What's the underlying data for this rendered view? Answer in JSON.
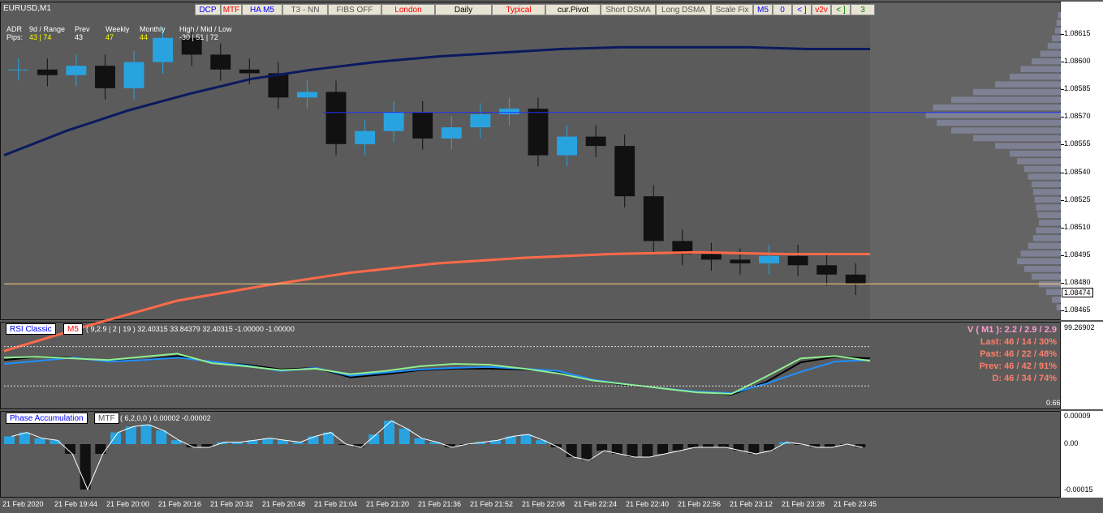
{
  "window": {
    "symbol_title": "EURUSD,M1"
  },
  "toolbar": [
    {
      "label": "DCP",
      "color": "#0000ff"
    },
    {
      "label": "MTF",
      "color": "#ff0000"
    },
    {
      "label": "HA M5",
      "color": "#0000ff"
    },
    {
      "label": "T3 - NN",
      "color": "#555555"
    },
    {
      "label": "FIBS OFF",
      "color": "#555555"
    },
    {
      "label": "London",
      "color": "#ff0000"
    },
    {
      "label": "Daily",
      "color": "#000000"
    },
    {
      "label": "Typical",
      "color": "#ff0000"
    },
    {
      "label": "cur.Pivot",
      "color": "#000000"
    },
    {
      "label": "Short DSMA",
      "color": "#555555"
    },
    {
      "label": "Long DSMA",
      "color": "#555555"
    },
    {
      "label": "Scale Fix",
      "color": "#555555"
    },
    {
      "label": "M5",
      "color": "#0000ff"
    },
    {
      "label": "0",
      "color": "#0000ff"
    },
    {
      "label": "< ]",
      "color": "#0000ff"
    },
    {
      "label": "v2v",
      "color": "#ff0000"
    },
    {
      "label": "< ]",
      "color": "#008000"
    },
    {
      "label": "3",
      "color": "#008000"
    }
  ],
  "adr_panel": {
    "row1": {
      "label": "ADR",
      "range": "9d / Range",
      "prev": "Prev",
      "weekly": "Weekly",
      "monthly": "Monthly",
      "hml": "High / Mid / Low"
    },
    "row2": {
      "label": "Pips:",
      "range": "43 | 74",
      "prev": "43",
      "weekly": "47",
      "monthly": "44",
      "hml": "-30 | 51 | 72"
    }
  },
  "price_axis": {
    "ticks": [
      "1.08615",
      "1.08600",
      "1.08585",
      "1.08570",
      "1.08555",
      "1.08540",
      "1.08525",
      "1.08510",
      "1.08495",
      "1.08480",
      "1.08465"
    ],
    "current_price": "1.08474"
  },
  "rsi": {
    "name": "RSI Classic",
    "tf": "M5",
    "params": "( 9,2.9 | 2 | 19 ) 32.40315 33.84379 32.40315 -1.00000 -1.00000",
    "axis_top": "99.26902",
    "axis_bottom": "0.66361",
    "stats": [
      {
        "text": "V ( M1 ): 2.2 / 2.9 / 2.9",
        "color": "#ff9ad0"
      },
      {
        "text": "Last: 46 / 14 / 30%",
        "color": "#ff7f6a"
      },
      {
        "text": "Past: 46 / 22 / 48%",
        "color": "#ff7f6a"
      },
      {
        "text": "Prev: 46 / 42 / 91%",
        "color": "#ff7f6a"
      },
      {
        "text": "D: 46 / 34 / 74%",
        "color": "#ff7f6a"
      }
    ]
  },
  "phase": {
    "name": "Phase Accumulation",
    "tf": "MTF",
    "params": "( 6,2,0,0 ) 0.00002 -0.00002",
    "ticks": [
      "0.00009",
      "0.00",
      "-0.00015"
    ]
  },
  "time_axis": [
    "21 Feb 2020",
    "21 Feb 19:44",
    "21 Feb 20:00",
    "21 Feb 20:16",
    "21 Feb 20:32",
    "21 Feb 20:48",
    "21 Feb 21:04",
    "21 Feb 21:20",
    "21 Feb 21:36",
    "21 Feb 21:52",
    "21 Feb 22:08",
    "21 Feb 22:24",
    "21 Feb 22:40",
    "21 Feb 22:56",
    "21 Feb 23:12",
    "21 Feb 23:28",
    "21 Feb 23:45"
  ],
  "chart_data": [
    {
      "type": "line",
      "series": [
        {
          "values": [
            1.08589,
            1.08586,
            1.08591,
            1.08579,
            1.08593,
            1.08606,
            1.08597,
            1.08589,
            1.08587,
            1.08574,
            1.08577,
            1.08549,
            1.08556,
            1.08566,
            1.08552,
            1.08558,
            1.08565,
            1.08568,
            1.08543,
            1.08553,
            1.08548,
            1.08521,
            1.08497,
            1.0849,
            1.08487,
            1.08485,
            1.08489,
            1.08484,
            1.08479,
            1.08474
          ],
          "color": "#1a1a1a"
        },
        {
          "values": [
            1.08543,
            1.08556,
            1.08567,
            1.08576,
            1.08584,
            1.08589,
            1.08593,
            1.08596,
            1.08598,
            1.086,
            1.08601,
            1.08601,
            1.08601,
            1.086,
            1.086
          ],
          "color": "#0b1a5e"
        },
        {
          "values": [
            1.08438,
            1.08452,
            1.08465,
            1.08473,
            1.0848,
            1.08485,
            1.08488,
            1.0849,
            1.08491,
            1.0849,
            1.0849
          ],
          "color": "#ff6a4a"
        }
      ],
      "hlines": [
        {
          "value": 1.08566,
          "color": "#1f2fff"
        },
        {
          "value": 1.08474,
          "color": "#ffd27f"
        }
      ],
      "ylim": [
        1.08455,
        1.08625
      ]
    },
    {
      "type": "line",
      "series": [
        {
          "values": [
            58,
            62,
            61,
            57,
            58,
            63,
            55,
            52,
            46,
            48,
            36,
            40,
            45,
            47,
            47,
            46,
            43,
            32,
            26,
            22,
            18,
            14,
            30,
            55,
            62,
            60
          ],
          "color": "#000000"
        },
        {
          "values": [
            53,
            57,
            61,
            56,
            58,
            61,
            56,
            51,
            44,
            48,
            38,
            42,
            46,
            48,
            49,
            47,
            44,
            33,
            27,
            22,
            18,
            16,
            28,
            43,
            56,
            58
          ],
          "color": "#1e90ff"
        },
        {
          "values": [
            61,
            62,
            60,
            58,
            62,
            66,
            54,
            50,
            45,
            47,
            40,
            44,
            50,
            53,
            52,
            47,
            41,
            32,
            27,
            22,
            17,
            15,
            37,
            60,
            63,
            57
          ],
          "color": "#90ee90"
        }
      ],
      "ylim": [
        0.66361,
        99.26902
      ]
    },
    {
      "type": "bar",
      "values": [
        4,
        6,
        3,
        2,
        -3,
        -14,
        -3,
        6,
        9,
        10,
        7,
        2,
        -1,
        -1,
        1,
        1,
        2,
        3,
        2,
        1,
        4,
        6,
        0,
        -1,
        5,
        12,
        8,
        3,
        1,
        -1,
        0,
        1,
        2,
        4,
        5,
        2,
        -1,
        -4,
        -5,
        -2,
        -3,
        -4,
        -4,
        -3,
        -2,
        -1,
        -1,
        -1,
        -2,
        -3,
        -2,
        1,
        0,
        -1,
        -1,
        0,
        -1
      ],
      "ylim": [
        -0.00015,
        9e-05
      ]
    }
  ]
}
